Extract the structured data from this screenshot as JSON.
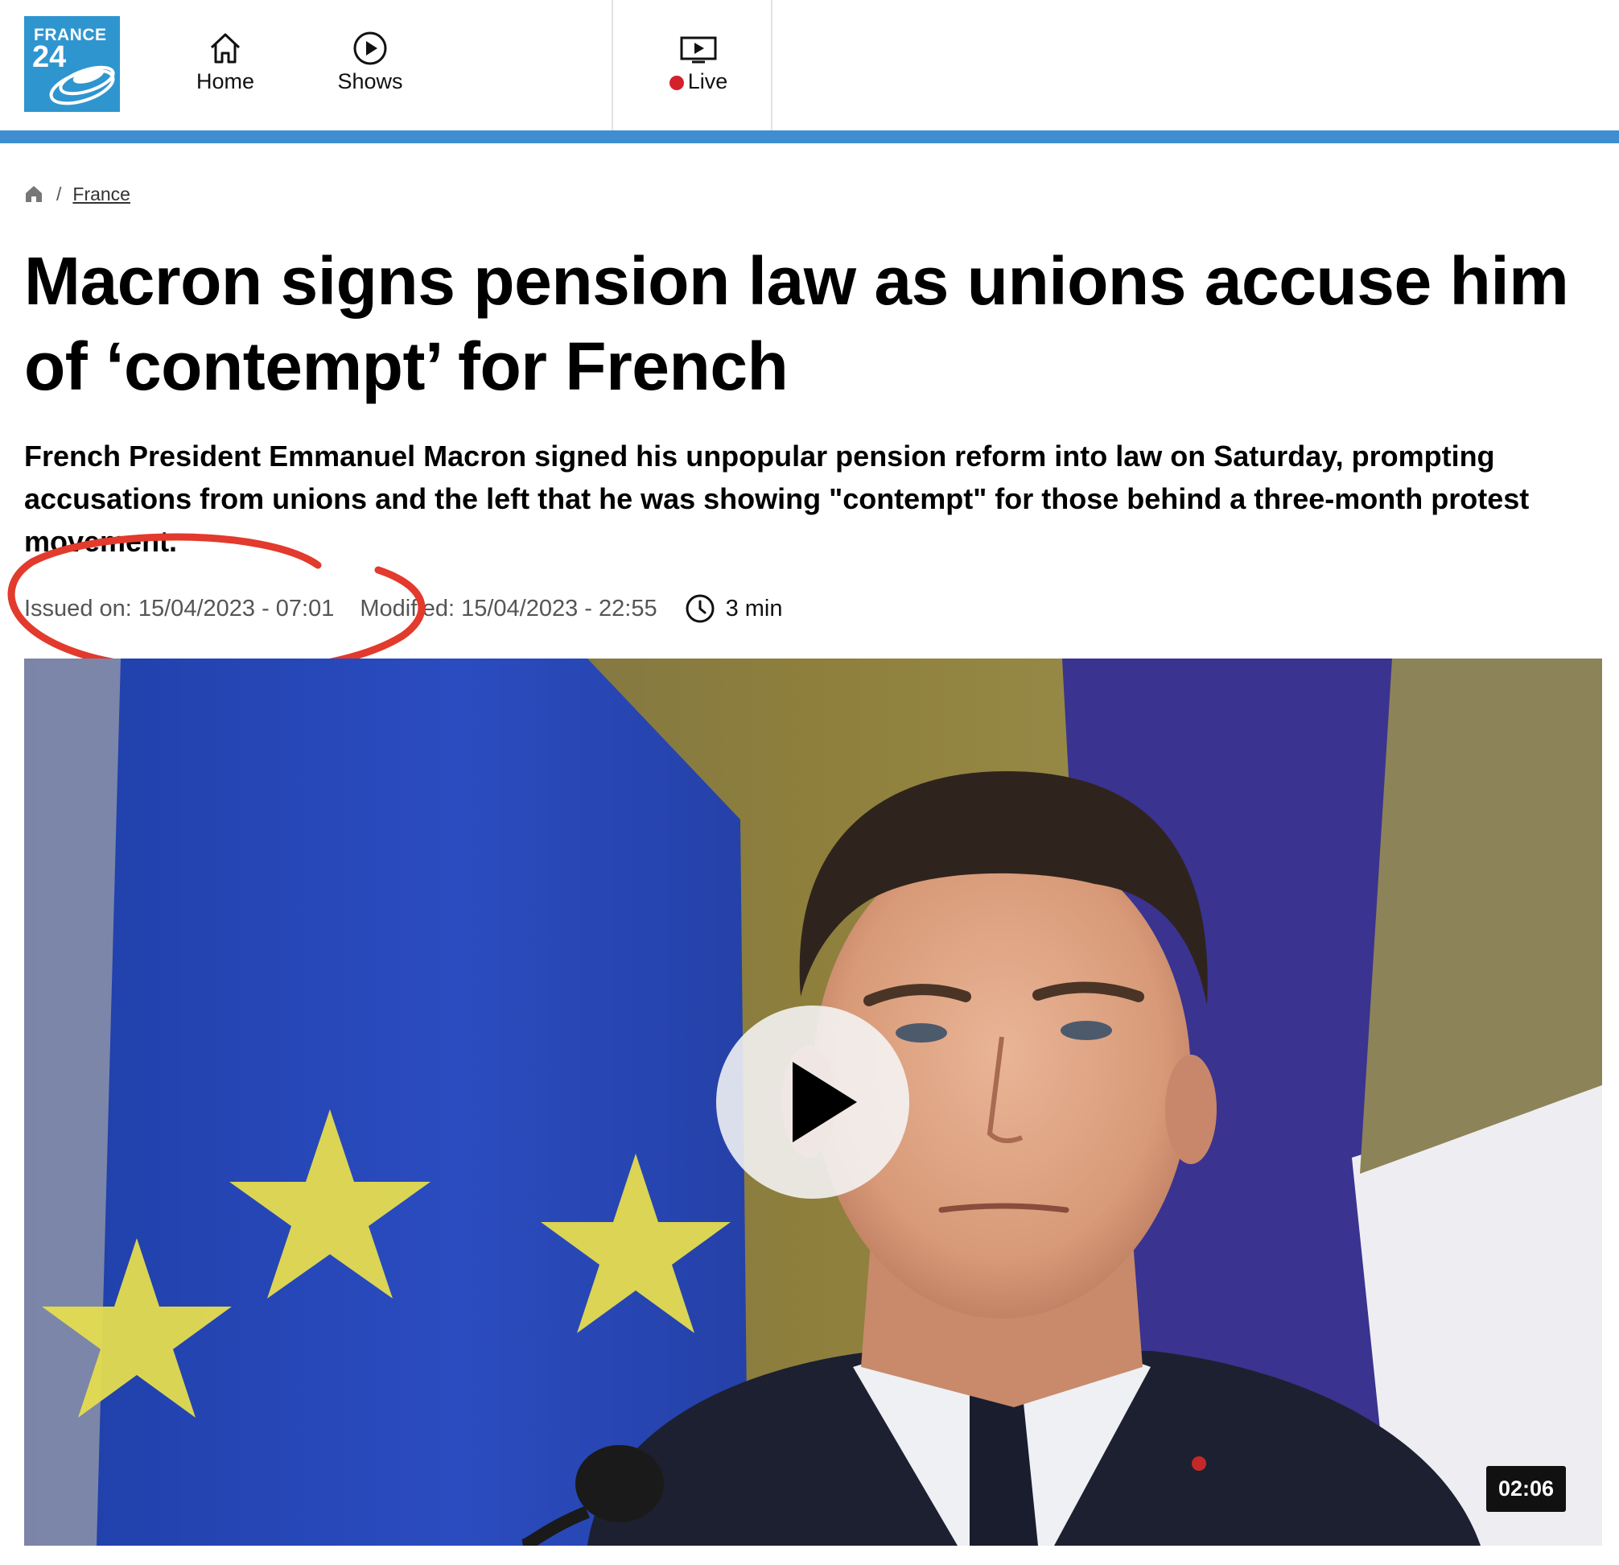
{
  "header": {
    "logo_line1": "FRANCE",
    "logo_line2": "24",
    "nav": {
      "home_label": "Home",
      "shows_label": "Shows",
      "live_label": "Live"
    },
    "icons": {
      "home": "home-icon",
      "shows": "play-circle-icon",
      "live": "tv-icon"
    }
  },
  "breadcrumb": {
    "section": "France"
  },
  "article": {
    "title": "Macron signs pension law as unions accuse him of ‘contempt’ for French",
    "lead": "French President Emmanuel Macron signed his unpopular pension reform into law on Saturday, prompting accusations from unions and the left that he was showing \"contempt\" for those behind a three-month protest movement.",
    "issued": "Issued on: 15/04/2023 - 07:01",
    "modified": "Modified: 15/04/2023 - 22:55",
    "read_time": "3 min"
  },
  "video": {
    "duration": "02:06"
  },
  "colors": {
    "brand_blue": "#2f95cf",
    "header_bar": "#3f8fd0",
    "live_red": "#d3202a",
    "annotation_red": "#e23a2c"
  }
}
